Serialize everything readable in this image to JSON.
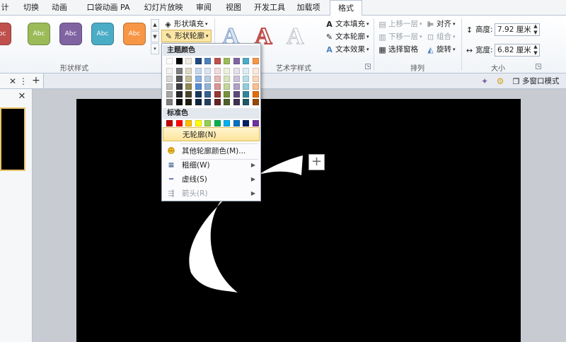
{
  "tabs": [
    "计",
    "切换",
    "动画",
    "口袋动画 PA",
    "幻灯片放映",
    "审阅",
    "视图",
    "开发工具",
    "加载项",
    "格式"
  ],
  "shape_styles": {
    "sample_text": "Abc",
    "colors": [
      "#c0504d",
      "#9bbb59",
      "#8064a2",
      "#4bacc6",
      "#f79646"
    ],
    "group_label": "形状样式"
  },
  "shape_buttons": {
    "fill": "形状填充",
    "outline": "形状轮廓"
  },
  "wordart": {
    "letter": "A",
    "group_label": "艺术字样式",
    "text_fill": "文本填充",
    "text_outline": "文本轮廓",
    "text_effects": "文本效果"
  },
  "arrange": {
    "bring_forward": "上移一层",
    "send_backward": "下移一层",
    "selection_pane": "选择窗格",
    "align": "对齐",
    "group": "组合",
    "rotate": "旋转",
    "group_label": "排列"
  },
  "size": {
    "height_label": "高度:",
    "height_value": "7.92 厘米",
    "width_label": "宽度:",
    "width_value": "6.82 厘米",
    "group_label": "大小"
  },
  "subbar": {
    "multi_window": "多窗口模式"
  },
  "dropdown": {
    "theme_colors_label": "主题颜色",
    "standard_colors_label": "标准色",
    "theme_top_row": [
      "#ffffff",
      "#000000",
      "#eeece1",
      "#1f497d",
      "#4f81bd",
      "#c0504d",
      "#9bbb59",
      "#8064a2",
      "#4bacc6",
      "#f79646"
    ],
    "theme_shades": [
      [
        "#f2f2f2",
        "#7f7f7f",
        "#ddd9c3",
        "#c6d9f0",
        "#dbe5f1",
        "#f2dcdb",
        "#ebf1dd",
        "#e5e0ec",
        "#dbeef3",
        "#fdeada"
      ],
      [
        "#d8d8d8",
        "#595959",
        "#c4bd97",
        "#8db3e2",
        "#b8cce4",
        "#e5b9b7",
        "#d7e3bc",
        "#ccc1d9",
        "#b7dde8",
        "#fbd5b5"
      ],
      [
        "#bfbfbf",
        "#3f3f3f",
        "#938953",
        "#548dd4",
        "#95b3d7",
        "#d99694",
        "#c3d69b",
        "#b2a2c7",
        "#92cddc",
        "#fac08f"
      ],
      [
        "#a5a5a5",
        "#262626",
        "#494429",
        "#17365d",
        "#366092",
        "#953734",
        "#76923c",
        "#5f497a",
        "#31859b",
        "#e36c09"
      ],
      [
        "#7f7f7f",
        "#0c0c0c",
        "#1d1b10",
        "#0f243e",
        "#244061",
        "#632423",
        "#4f6128",
        "#3f3151",
        "#205867",
        "#974806"
      ]
    ],
    "standard_colors": [
      "#c00000",
      "#ff0000",
      "#ffc000",
      "#ffff00",
      "#92d050",
      "#00b050",
      "#00b0f0",
      "#0070c0",
      "#002060",
      "#7030a0"
    ],
    "no_outline": "无轮廓(N)",
    "more_colors": "其他轮廓颜色(M)...",
    "weight": "粗细(W)",
    "dashes": "虚线(S)",
    "arrows": "箭头(R)"
  }
}
